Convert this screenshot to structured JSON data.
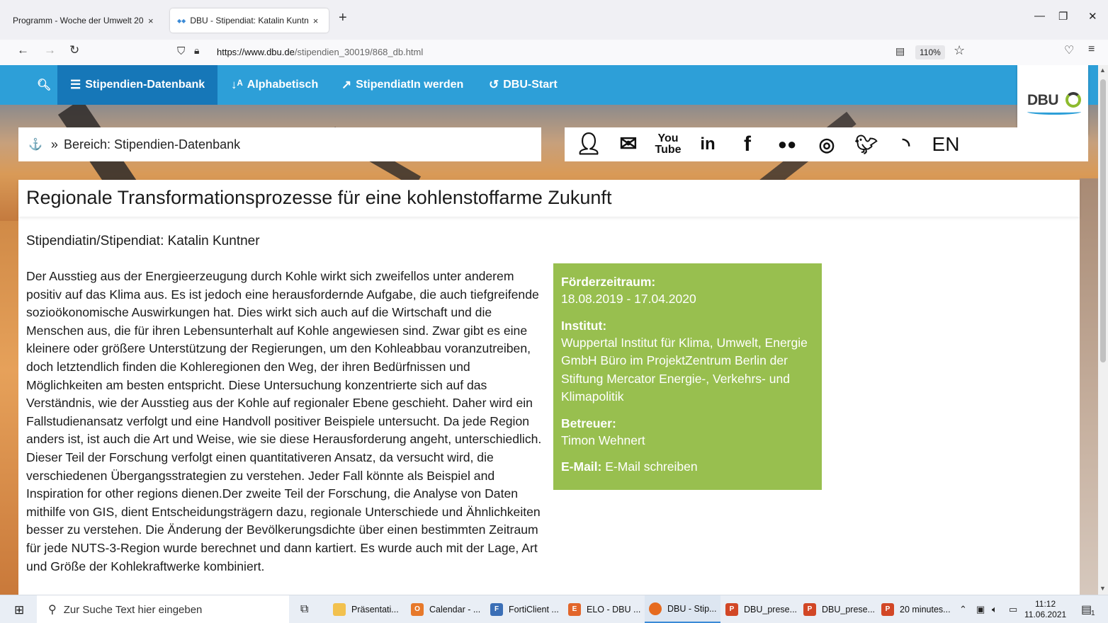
{
  "browser": {
    "tabs": [
      {
        "title": "Programm - Woche der Umwelt 202",
        "close": "×"
      },
      {
        "title": "DBU - Stipendiat: Katalin Kuntn",
        "close": "×"
      }
    ],
    "new_tab": "+",
    "url_domain": "https://www.dbu.de",
    "url_path": "/stipendien_30019/868_db.html",
    "zoom": "110%",
    "window_controls": {
      "minimize": "—",
      "restore": "❐",
      "close": "✕"
    }
  },
  "site_nav": {
    "items": [
      {
        "label": "Stipendien-Datenbank",
        "icon": "database-icon"
      },
      {
        "label": "Alphabetisch",
        "icon": "sort-alpha-icon"
      },
      {
        "label": "StipendiatIn werden",
        "icon": "external-link-icon"
      },
      {
        "label": "DBU-Start",
        "icon": "undo-icon"
      }
    ],
    "logo_text": "DBU"
  },
  "breadcrumb": {
    "separator": "»",
    "text": "Bereich: Stipendien-Datenbank"
  },
  "social": {
    "language": "EN"
  },
  "article": {
    "title": "Regionale Transformationsprozesse für eine kohlenstoffarme Zukunft",
    "person": "Stipendiatin/Stipendiat: Katalin Kuntner",
    "description": "Der Ausstieg aus der Energieerzeugung durch Kohle wirkt sich zweifellos unter anderem positiv auf das Klima aus. Es ist jedoch eine herausfordernde Aufgabe, die auch tiefgreifende sozioökonomische Auswirkungen hat. Dies wirkt sich auch auf die Wirtschaft und die Menschen aus, die für ihren Lebensunterhalt auf Kohle angewiesen sind. Zwar gibt es eine kleinere oder größere Unterstützung der Regierungen, um den Kohleabbau voranzutreiben, doch letztendlich finden die Kohleregionen den Weg, der ihren Bedürfnissen und Möglichkeiten am besten entspricht. Diese Untersuchung konzentrierte sich auf das Verständnis, wie der Ausstieg aus der Kohle auf regionaler Ebene geschieht. Daher wird ein Fallstudienansatz verfolgt und eine Handvoll positiver Beispiele untersucht. Da jede Region anders ist, ist auch die Art und Weise, wie sie diese Herausforderung angeht, unterschiedlich. Dieser Teil der Forschung verfolgt einen quantitativeren Ansatz, da versucht wird, die verschiedenen Übergangsstrategien zu verstehen. Jeder Fall könnte als Beispiel and Inspiration for other regions dienen.Der zweite Teil der Forschung, die Analyse von Daten mithilfe von GIS, dient Entscheidungsträgern dazu, regionale Unterschiede und Ähnlichkeiten besser zu verstehen. Die Änderung der Bevölkerungsdichte über einen bestimmten Zeitraum für jede NUTS-3-Region wurde berechnet und dann kartiert. Es wurde auch mit der Lage, Art und Größe der Kohlekraftwerke kombiniert."
  },
  "info": {
    "period_label": "Förderzeitraum:",
    "period_value": "18.08.2019 - 17.04.2020",
    "institute_label": "Institut:",
    "institute_value": "Wuppertal Institut für Klima, Umwelt, Energie GmbH Büro im ProjektZentrum Berlin der Stiftung Mercator Energie-, Verkehrs- und Klimapolitik",
    "supervisor_label": "Betreuer:",
    "supervisor_value": "Timon Wehnert",
    "email_label": "E-Mail:",
    "email_link": "E-Mail schreiben",
    "color": "#98bf4f"
  },
  "taskbar": {
    "search_placeholder": "Zur Suche Text hier eingeben",
    "apps": [
      {
        "label": "Präsentati...",
        "color": "#f2c14e"
      },
      {
        "label": "Calendar - ...",
        "color": "#e7792b"
      },
      {
        "label": "FortiClient ...",
        "color": "#3b6fb6"
      },
      {
        "label": "ELO - DBU ...",
        "color": "#e2662b"
      },
      {
        "label": "DBU - Stip...",
        "color": "#e66b1f"
      },
      {
        "label": "DBU_prese...",
        "color": "#d24726"
      },
      {
        "label": "DBU_prese...",
        "color": "#d24726"
      },
      {
        "label": "20 minutes...",
        "color": "#d24726"
      }
    ],
    "time": "11:12",
    "date": "11.06.2021",
    "notification_count": "1"
  }
}
